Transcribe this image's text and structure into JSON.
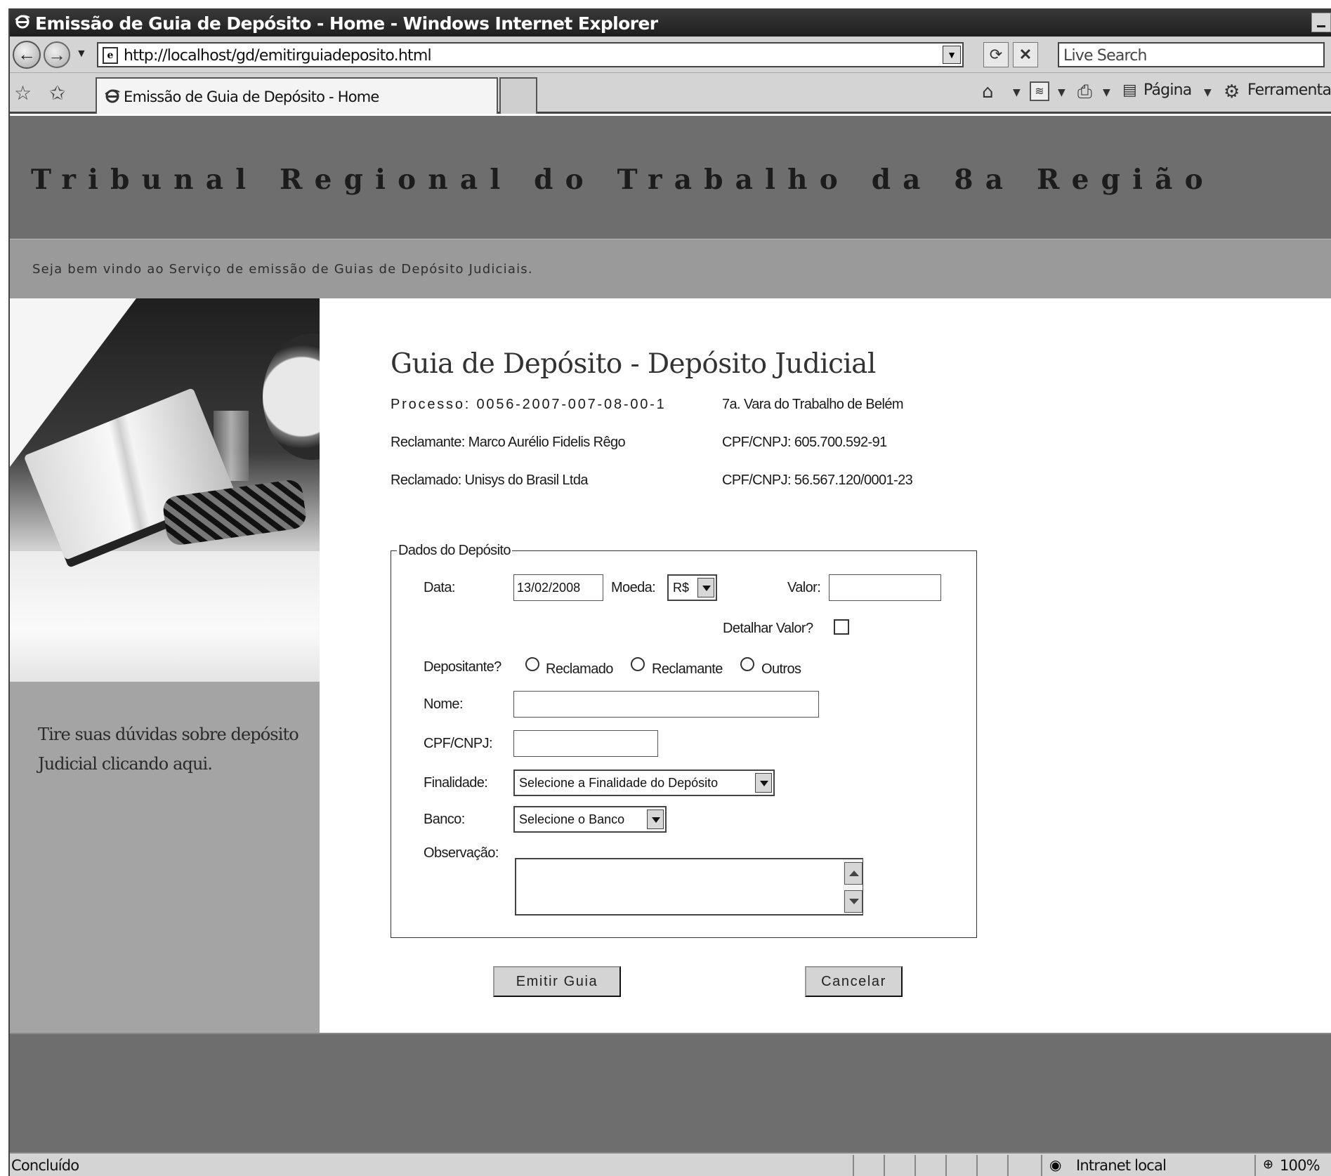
{
  "browser": {
    "window_title": "Emissão de Guia de Depósito - Home - Windows Internet Explorer",
    "url": "http://localhost/gd/emitirguiadeposito.html",
    "search_placeholder": "Live Search",
    "tab_title": "Emissão de Guia de Depósito - Home",
    "command_bar": {
      "page_label": "Página",
      "tools_label": "Ferramentas"
    },
    "status": {
      "text": "Concluído",
      "zone": "Intranet local",
      "zoom": "100%"
    }
  },
  "site": {
    "title": "Tribunal Regional do Trabalho da 8a Região",
    "welcome": "Seja bem vindo ao Serviço de emissão de Guias de Depósito Judiciais.",
    "help_text": "Tire suas dúvidas sobre depósito Judicial clicando aqui."
  },
  "page": {
    "title": "Guia de Depósito - Depósito Judicial",
    "processo": "Processo: 0056-2007-007-08-00-1",
    "vara": "7a. Vara do Trabalho de Belém",
    "reclamante": "Reclamante: Marco Aurélio Fidelis Rêgo",
    "reclamante_doc": "CPF/CNPJ: 605.700.592-91",
    "reclamado": "Reclamado: Unisys do Brasil Ltda",
    "reclamado_doc": "CPF/CNPJ: 56.567.120/0001-23"
  },
  "form": {
    "legend": "Dados do Depósito",
    "data_label": "Data:",
    "data_value": "13/02/2008",
    "moeda_label": "Moeda:",
    "moeda_value": "R$",
    "valor_label": "Valor:",
    "valor_value": "",
    "detalhar_label": "Detalhar Valor?",
    "detalhar_checked": false,
    "depositante_label": "Depositante?",
    "depositante_options": [
      "Reclamado",
      "Reclamante",
      "Outros"
    ],
    "nome_label": "Nome:",
    "nome_value": "",
    "cpf_label": "CPF/CNPJ:",
    "cpf_value": "",
    "finalidade_label": "Finalidade:",
    "finalidade_value": "Selecione a Finalidade do Depósito",
    "banco_label": "Banco:",
    "banco_value": "Selecione o Banco",
    "observacao_label": "Observação:",
    "observacao_value": "",
    "submit_label": "Emitir Guia",
    "cancel_label": "Cancelar"
  },
  "icons": {
    "ie_logo": "ie-logo-icon",
    "back": "back-arrow-icon",
    "forward": "forward-arrow-icon",
    "refresh": "refresh-icon",
    "stop": "stop-icon",
    "favorites": "star-icon",
    "home": "home-icon",
    "feeds": "feed-icon",
    "print": "print-icon",
    "page": "page-icon",
    "tools": "gear-icon",
    "zone": "intranet-icon",
    "zoom": "zoom-icon"
  },
  "colors": {
    "header_bg": "#6e6e6e",
    "subbar_bg": "#9a9a9a",
    "left_col_bg": "#a4a4a4",
    "chrome_bg": "#d4d4d4"
  }
}
